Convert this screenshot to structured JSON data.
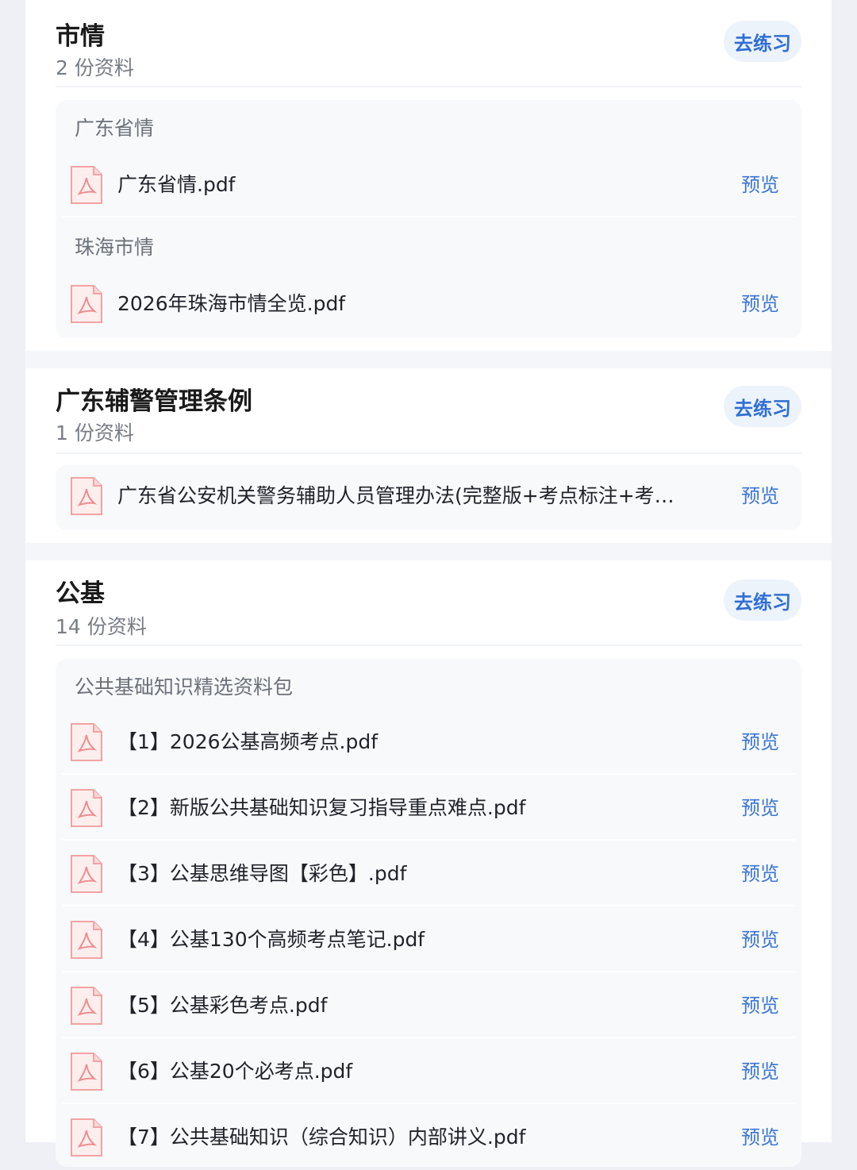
{
  "practice_label": "去练习",
  "preview_label": "预览",
  "sections": [
    {
      "title": "市情",
      "count": "2 份资料",
      "groups": [
        {
          "title": "广东省情",
          "files": [
            "广东省情.pdf"
          ]
        },
        {
          "title": "珠海市情",
          "files": [
            "2026年珠海市情全览.pdf"
          ]
        }
      ]
    },
    {
      "title": "广东辅警管理条例",
      "count": "1 份资料",
      "groups": [
        {
          "title": "",
          "files": [
            "广东省公安机关警务辅助人员管理办法(完整版+考点标注+考…"
          ]
        }
      ]
    },
    {
      "title": "公基",
      "count": "14 份资料",
      "groups": [
        {
          "title": "公共基础知识精选资料包",
          "files": [
            "【1】2026公基高频考点.pdf",
            "【2】新版公共基础知识复习指导重点难点.pdf",
            "【3】公基思维导图【彩色】.pdf",
            "【4】公基130个高频考点笔记.pdf",
            "【5】公基彩色考点.pdf",
            "【6】公基20个必考点.pdf",
            "【7】公共基础知识（综合知识）内部讲义.pdf"
          ]
        }
      ]
    }
  ]
}
